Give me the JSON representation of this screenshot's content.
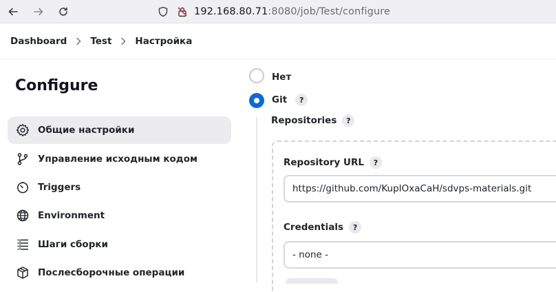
{
  "browser": {
    "url_host": "192.168.80.71",
    "url_path": ":8080/job/Test/configure"
  },
  "breadcrumb": {
    "items": [
      "Dashboard",
      "Test",
      "Настройка"
    ]
  },
  "sidebar": {
    "title": "Configure",
    "items": [
      {
        "label": "Общие настройки",
        "icon": "gear-icon",
        "active": true
      },
      {
        "label": "Управление исходным кодом",
        "icon": "branch-icon",
        "active": false
      },
      {
        "label": "Triggers",
        "icon": "timer-icon",
        "active": false
      },
      {
        "label": "Environment",
        "icon": "globe-icon",
        "active": false
      },
      {
        "label": "Шаги сборки",
        "icon": "list-icon",
        "active": false
      },
      {
        "label": "Послесборочные операции",
        "icon": "package-icon",
        "active": false
      }
    ]
  },
  "scm": {
    "options": [
      {
        "label": "Нет",
        "checked": false
      },
      {
        "label": "Git",
        "checked": true
      }
    ],
    "help_glyph": "?",
    "repositories_label": "Repositories",
    "repository_url_label": "Repository URL",
    "repository_url_value": "https://github.com/KupIOxaCaH/sdvps-materials.git",
    "credentials_label": "Credentials",
    "credentials_value": "- none -"
  },
  "colors": {
    "accent": "#0b6bd6",
    "active_bg": "#ececef"
  }
}
